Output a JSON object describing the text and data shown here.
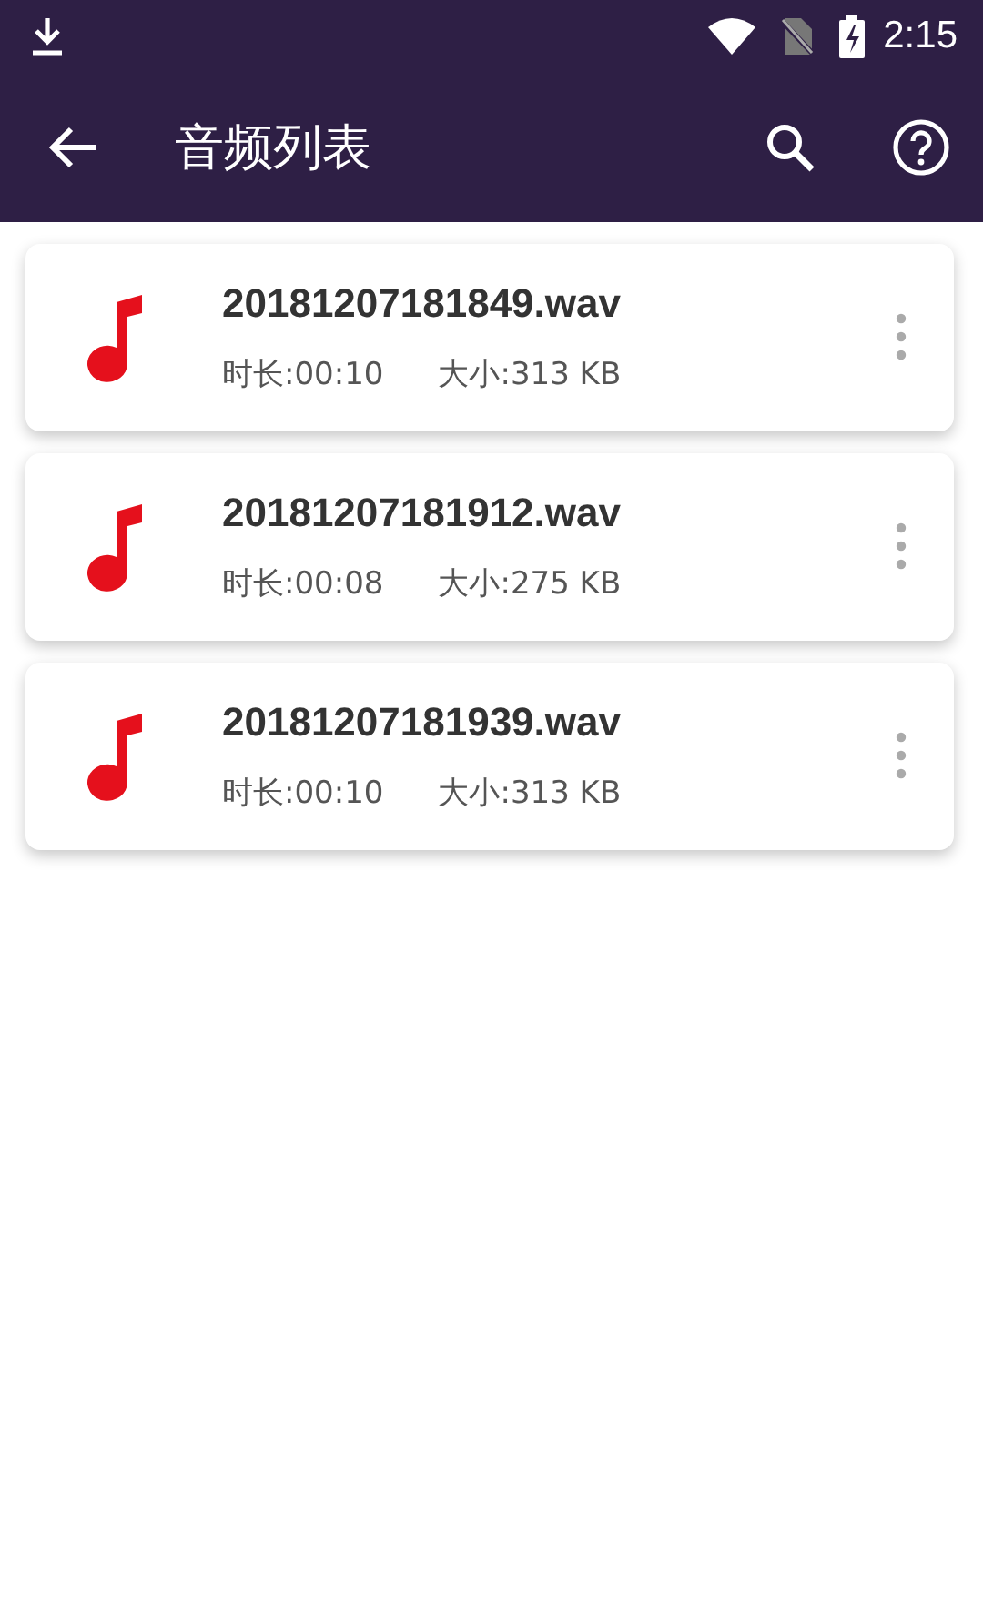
{
  "status_bar": {
    "time": "2:15"
  },
  "app_bar": {
    "title": "音频列表"
  },
  "files": [
    {
      "name": "20181207181849.wav",
      "duration": "时长:00:10",
      "size": "大小:313 KB"
    },
    {
      "name": "20181207181912.wav",
      "duration": "时长:00:08",
      "size": "大小:275 KB"
    },
    {
      "name": "20181207181939.wav",
      "duration": "时长:00:10",
      "size": "大小:313 KB"
    }
  ]
}
